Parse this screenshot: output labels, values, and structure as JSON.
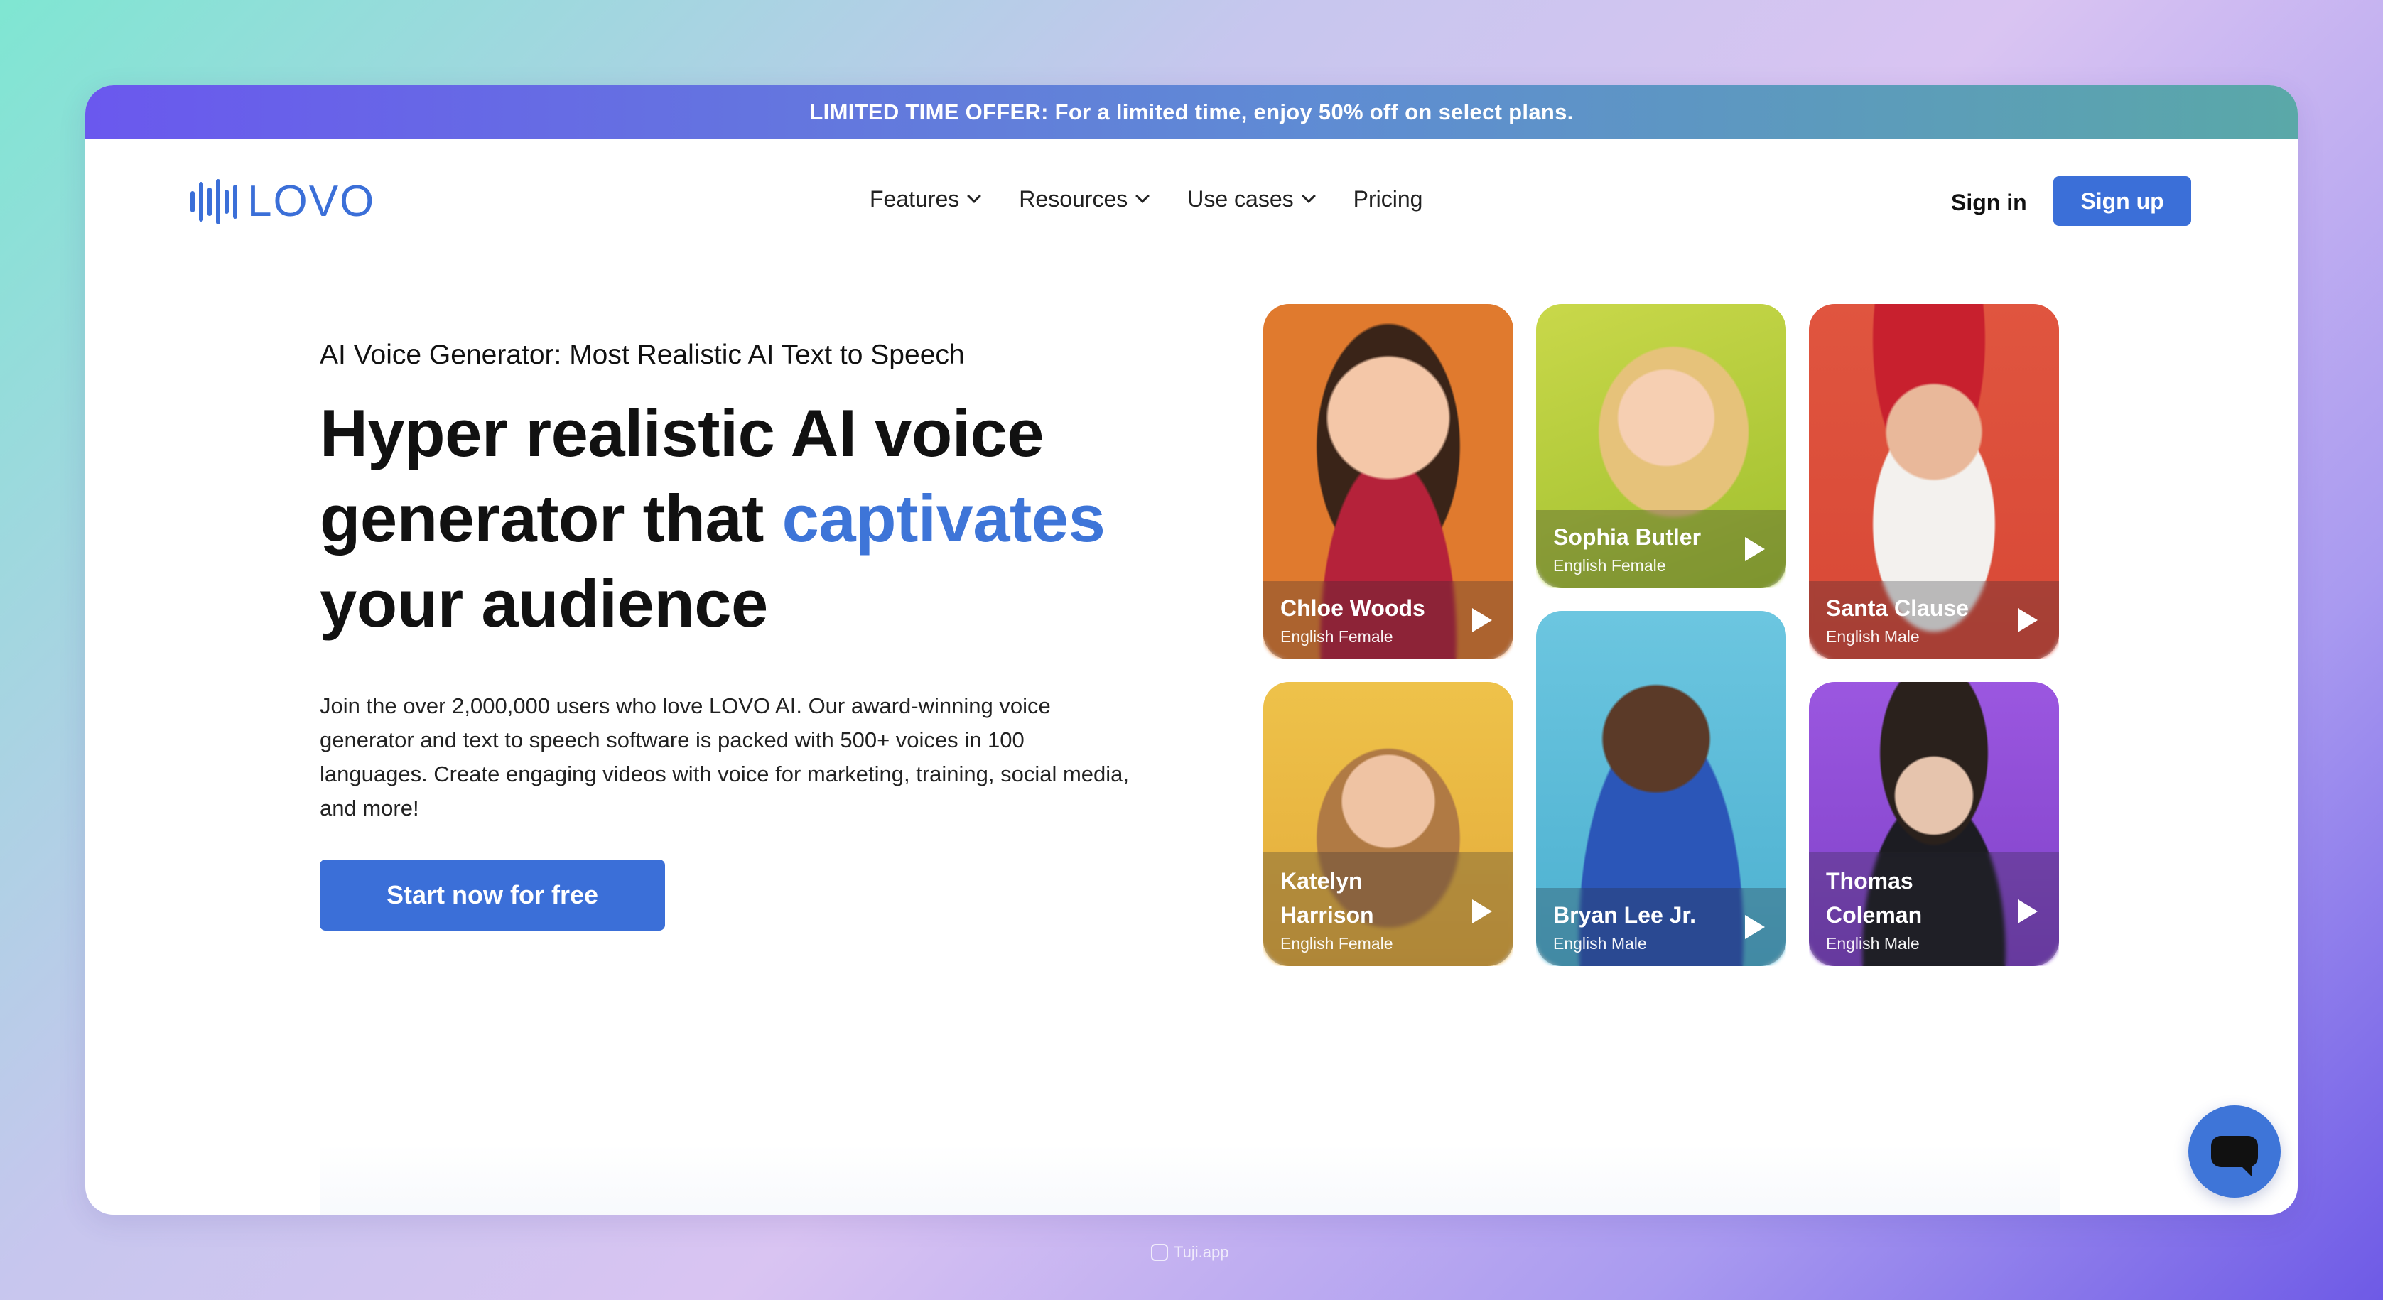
{
  "promo": {
    "text": "LIMITED TIME OFFER: For a limited time, enjoy 50% off on select plans."
  },
  "brand": {
    "name": "LOVO",
    "color": "#3b6fd8"
  },
  "nav": {
    "items": [
      {
        "label": "Features",
        "has_dropdown": true
      },
      {
        "label": "Resources",
        "has_dropdown": true
      },
      {
        "label": "Use cases",
        "has_dropdown": true
      },
      {
        "label": "Pricing",
        "has_dropdown": false
      }
    ],
    "signin": "Sign in",
    "signup": "Sign up"
  },
  "hero": {
    "subtitle": "AI Voice Generator: Most Realistic AI Text to Speech",
    "title_line1": "Hyper realistic AI voice",
    "title_line2_a": "generator that ",
    "title_line2_accent": "captivates",
    "title_line3": "your audience",
    "description": "Join the over 2,000,000 users who love LOVO AI. Our award-winning voice generator and text to speech software is packed with 500+ voices in 100 languages. Create engaging videos with voice for marketing, training, social media, and more!",
    "cta": "Start now for free",
    "accent_color": "#3e75d8"
  },
  "voices": [
    {
      "name": "Chloe Woods",
      "lang": "English Female",
      "bg": "#e07a2e"
    },
    {
      "name": "Sophia Butler",
      "lang": "English Female",
      "bg": "#b8cf3a"
    },
    {
      "name": "Santa Clause",
      "lang": "English Male",
      "bg": "#e0553f"
    },
    {
      "name": "Katelyn Harrison",
      "lang": "English Female",
      "bg": "#e8b843"
    },
    {
      "name": "Bryan Lee Jr.",
      "lang": "English Male",
      "bg": "#5bbad6"
    },
    {
      "name": "Thomas Coleman",
      "lang": "English Male",
      "bg": "#8e4fd6"
    }
  ],
  "watermark": "Tuji.app"
}
